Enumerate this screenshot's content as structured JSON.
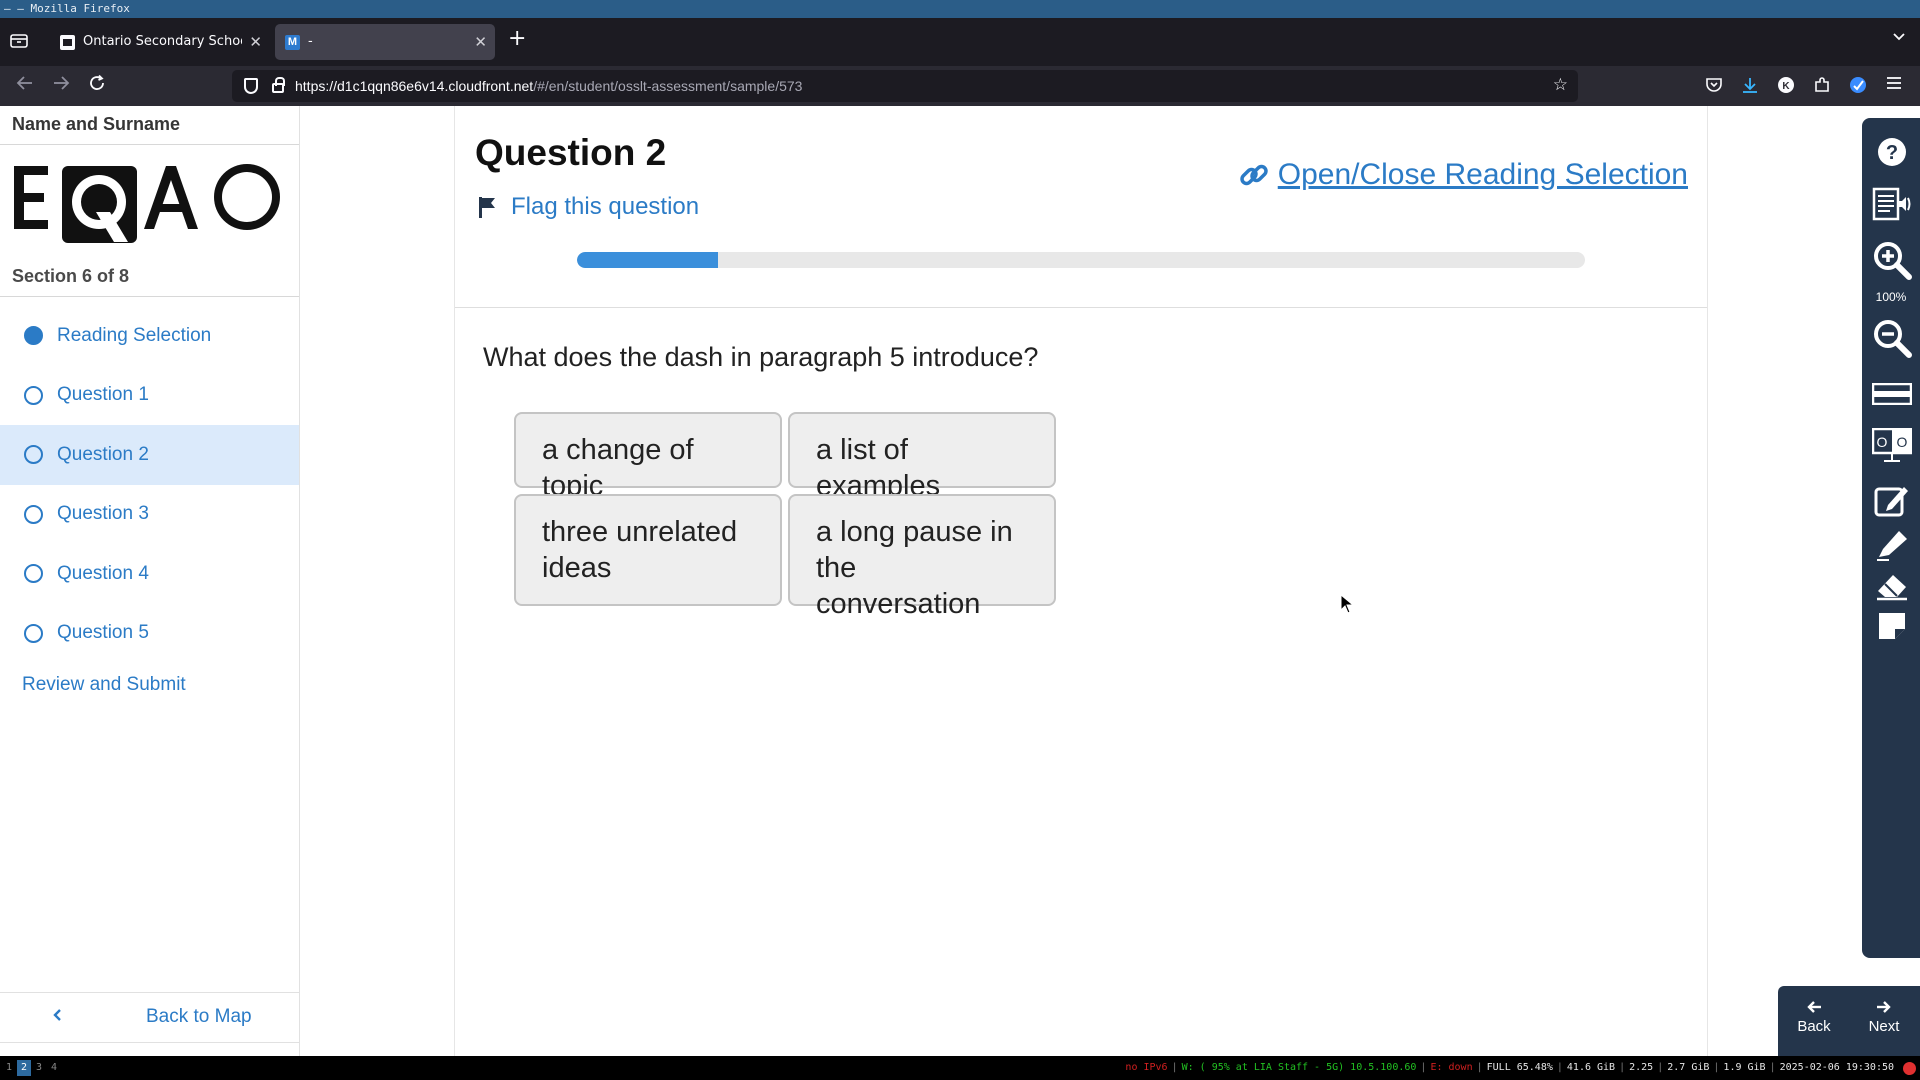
{
  "window": {
    "title": "– – Mozilla Firefox"
  },
  "browser": {
    "tabs": [
      {
        "label": "Ontario Secondary School",
        "active": false
      },
      {
        "label": "-",
        "active": true,
        "favicon_letter": "M"
      }
    ],
    "url_host": "https://d1c1qqn86e6v14.cloudfront.net",
    "url_path": "/#/en/student/osslt-assessment/sample/573"
  },
  "sidebar": {
    "student_name": "Name and Surname",
    "logo_text": "EQAO",
    "section_label": "Section 6 of 8",
    "items": [
      {
        "label": "Reading Selection",
        "completed": true,
        "active": false
      },
      {
        "label": "Question 1",
        "completed": false,
        "active": false
      },
      {
        "label": "Question 2",
        "completed": false,
        "active": true
      },
      {
        "label": "Question 3",
        "completed": false,
        "active": false
      },
      {
        "label": "Question 4",
        "completed": false,
        "active": false
      },
      {
        "label": "Question 5",
        "completed": false,
        "active": false
      }
    ],
    "review_label": "Review and Submit",
    "back_to_map": "Back to Map"
  },
  "question": {
    "title": "Question 2",
    "flag_label": "Flag this question",
    "open_reading_label": "Open/Close Reading Selection",
    "progress_fraction": 0.14,
    "prompt": "What does the dash in paragraph 5 introduce?",
    "choices": [
      "a change of topic",
      "a list of examples",
      "three unrelated ideas",
      "a long pause in the conversation"
    ]
  },
  "tools": {
    "zoom_level": "100%",
    "items": [
      "help-icon",
      "text-to-speech-icon",
      "zoom-in-icon",
      "zoom-out-icon",
      "line-reader-icon",
      "contrast-icon",
      "notepad-icon",
      "highlighter-icon",
      "eraser-icon",
      "sticky-note-icon"
    ]
  },
  "navigation": {
    "back_label": "Back",
    "next_label": "Next"
  },
  "statusbar": {
    "workspaces": [
      "1",
      "2",
      "3",
      "4"
    ],
    "current_workspace": "2",
    "ipv6": "no IPv6",
    "wifi": "W: ( 95% at LIA Staff - 5G) 10.5.100.60",
    "ethernet": "E: down",
    "battery": "FULL 65.48%",
    "disk": "41.6 GiB",
    "load": "2.25",
    "mem1": "2.7 GiB",
    "mem2": "1.9 GiB",
    "datetime": "2025-02-06 19:30:50"
  },
  "colors": {
    "accent": "#2b7bc6",
    "progress": "#3b8fdb",
    "tool_panel": "#24354b",
    "active_item_bg": "#dbeafb"
  }
}
